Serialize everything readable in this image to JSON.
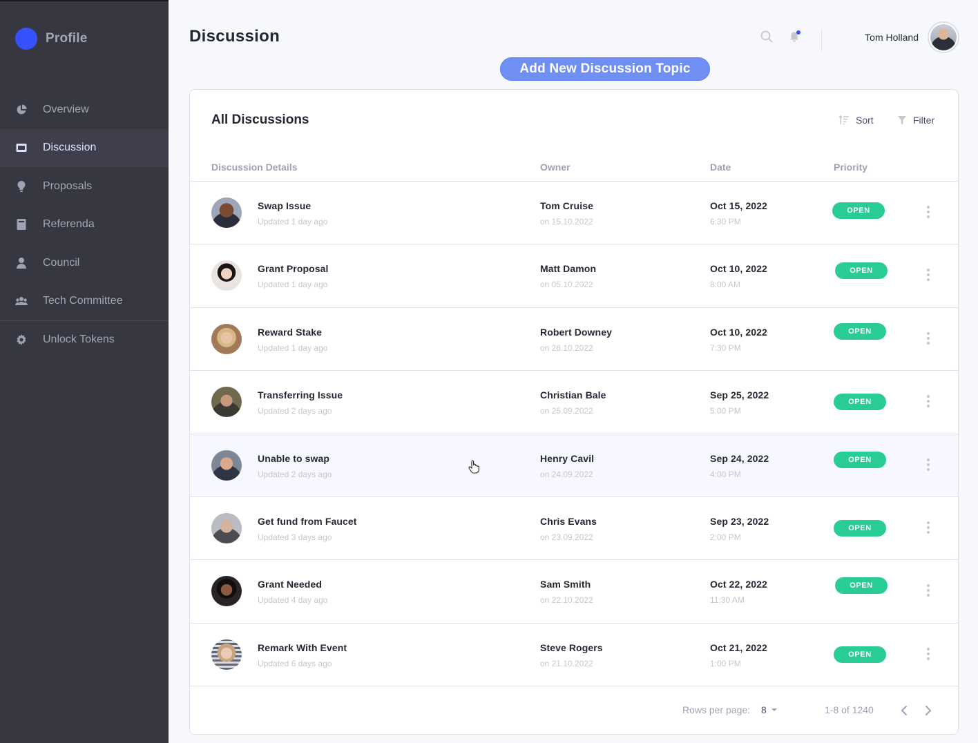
{
  "sidebar": {
    "brand": "Profile",
    "items": [
      {
        "label": "Overview",
        "icon": "pie-chart-icon"
      },
      {
        "label": "Discussion",
        "icon": "ticket-icon",
        "active": true
      },
      {
        "label": "Proposals",
        "icon": "lightbulb-icon"
      },
      {
        "label": "Referenda",
        "icon": "book-icon"
      },
      {
        "label": "Council",
        "icon": "person-icon"
      },
      {
        "label": "Tech Committee",
        "icon": "group-icon"
      },
      {
        "label": "Unlock Tokens",
        "icon": "gear-icon"
      }
    ]
  },
  "header": {
    "title": "Discussion",
    "user_name": "Tom Holland"
  },
  "add_button_label": "Add New Discussion Topic",
  "card": {
    "title": "All Discussions",
    "sort_label": "Sort",
    "filter_label": "Filter",
    "columns": [
      "Discussion Details",
      "Owner",
      "Date",
      "Priority"
    ],
    "rows": [
      {
        "title": "Swap Issue",
        "updated": "Updated 1 day ago",
        "owner": "Tom Cruise",
        "owner_date": "on 15.10.2022",
        "date": "Oct 15, 2022",
        "time": "6:30 PM",
        "priority": "OPEN"
      },
      {
        "title": "Grant Proposal",
        "updated": "Updated 1 day ago",
        "owner": "Matt Damon",
        "owner_date": "on 05.10.2022",
        "date": "Oct 10, 2022",
        "time": "8:00 AM",
        "priority": "OPEN"
      },
      {
        "title": "Reward Stake",
        "updated": "Updated 1 day ago",
        "owner": "Robert Downey",
        "owner_date": "on 26.10.2022",
        "date": "Oct 10, 2022",
        "time": "7:30 PM",
        "priority": "OPEN"
      },
      {
        "title": "Transferring Issue",
        "updated": "Updated 2 days ago",
        "owner": "Christian Bale",
        "owner_date": "on 25.09.2022",
        "date": "Sep 25, 2022",
        "time": "5:00 PM",
        "priority": "OPEN"
      },
      {
        "title": "Unable to swap",
        "updated": "Updated 2 days ago",
        "owner": "Henry Cavil",
        "owner_date": "on 24.09.2022",
        "date": "Sep 24, 2022",
        "time": "4:00 PM",
        "priority": "OPEN"
      },
      {
        "title": "Get fund from Faucet",
        "updated": "Updated 3 days ago",
        "owner": "Chris Evans",
        "owner_date": "on 23.09.2022",
        "date": "Sep 23, 2022",
        "time": "2:00 PM",
        "priority": "OPEN"
      },
      {
        "title": "Grant Needed",
        "updated": "Updated 4 day ago",
        "owner": "Sam Smith",
        "owner_date": "on 22.10.2022",
        "date": "Oct 22, 2022",
        "time": "11:30 AM",
        "priority": "OPEN"
      },
      {
        "title": "Remark With Event",
        "updated": "Updated 6 days ago",
        "owner": "Steve Rogers",
        "owner_date": "on 21.10.2022",
        "date": "Oct 21, 2022",
        "time": "1:00 PM",
        "priority": "OPEN"
      }
    ]
  },
  "pagination": {
    "rows_per_page_label": "Rows per page:",
    "rows_per_page": "8",
    "range": "1-8 of 1240"
  },
  "colors": {
    "sidebar_bg": "#363740",
    "accent": "#3751ff",
    "button": "#6f8ff5",
    "open_badge": "#29cc97"
  }
}
